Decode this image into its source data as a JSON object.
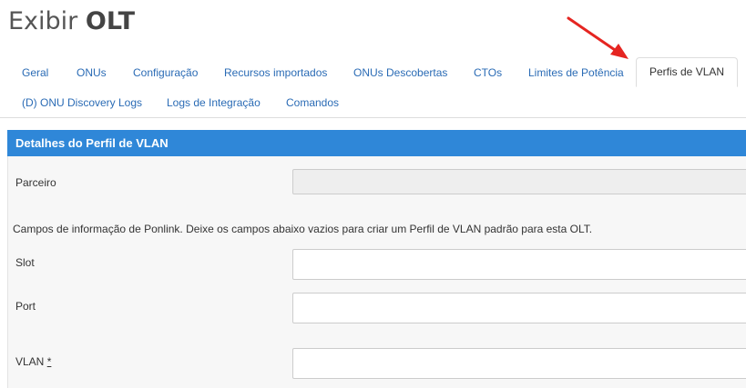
{
  "page": {
    "title_prefix": "Exibir",
    "title_strong": "OLT"
  },
  "tabs": [
    {
      "label": "Geral"
    },
    {
      "label": "ONUs"
    },
    {
      "label": "Configuração"
    },
    {
      "label": "Recursos importados"
    },
    {
      "label": "ONUs Descobertas"
    },
    {
      "label": "CTOs"
    },
    {
      "label": "Limites de Potência"
    },
    {
      "label": "Perfis de VLAN",
      "active": true
    },
    {
      "label": "(D) ONU Discovery Logs"
    },
    {
      "label": "Logs de Integração"
    },
    {
      "label": "Comandos"
    }
  ],
  "panel": {
    "title": "Detalhes do Perfil de VLAN",
    "info_text": "Campos de informação de Ponlink. Deixe os campos abaixo vazios para criar um Perfil de VLAN padrão para esta OLT.",
    "fields": {
      "parceiro": {
        "label": "Parceiro",
        "value": ""
      },
      "slot": {
        "label": "Slot",
        "value": ""
      },
      "port": {
        "label": "Port",
        "value": ""
      },
      "vlan": {
        "label": "VLAN",
        "required_mark": "*",
        "value": ""
      }
    }
  },
  "colors": {
    "panel_header": "#2f87d8",
    "tab_link": "#2a6bb5",
    "annotation_arrow": "#e52521"
  }
}
